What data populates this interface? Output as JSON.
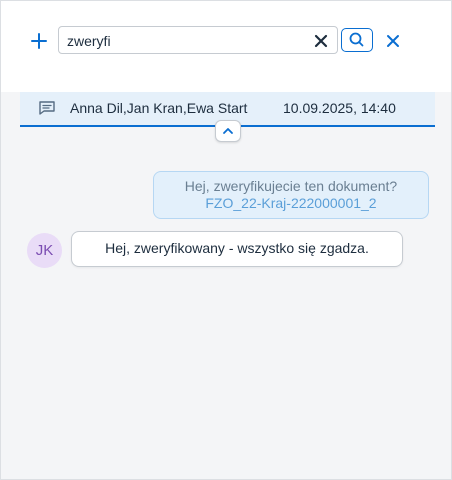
{
  "search": {
    "add_icon": "plus-icon",
    "query": "zweryfi",
    "clear_icon": "close-icon",
    "search_icon": "search-icon",
    "close_icon": "close-icon"
  },
  "conversation": {
    "icon": "message-icon",
    "participants": "Anna Dil,Jan Kran,Ewa Start",
    "datetime": "10.09.2025, 14:40",
    "collapse_icon": "chevron-up-icon"
  },
  "messages": [
    {
      "direction": "outgoing",
      "text": "Hej, zweryfikujecie ten dokument?",
      "link": "FZO_22-Kraj-222000001_2"
    },
    {
      "direction": "incoming",
      "avatar_initials": "JK",
      "text": "Hej, zweryfikowany - wszystko się zgadza."
    }
  ],
  "colors": {
    "accent": "#0a6ed1",
    "background": "#f4f5f7",
    "selected_row": "#e5f0fa",
    "avatar_bg": "#e9dcf7",
    "avatar_text": "#7b4db2"
  }
}
